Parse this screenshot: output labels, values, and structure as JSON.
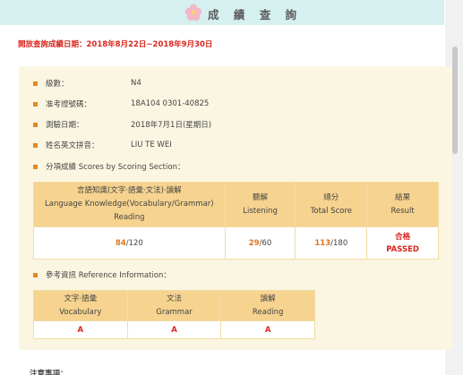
{
  "header": {
    "title": "成 績 查 詢",
    "icon": "flower-icon"
  },
  "notice": "開放查詢成績日期：2018年8月22日~2018年9月30日",
  "info": [
    {
      "label": "級數：",
      "value": "N4"
    },
    {
      "label": "准考證號碼：",
      "value": "18A104 0301-40825"
    },
    {
      "label": "測驗日期：",
      "value": "2018年7月1日(星期日)"
    },
    {
      "label": "姓名英文拼音：",
      "value": "LIU TE WEI"
    }
  ],
  "scoring_section_title": "分項成績 Scores by Scoring Section：",
  "score_table": {
    "headers": [
      {
        "line1": "言語知識(文字·語彙·文法)·讀解",
        "line2": "Language Knowledge(Vocabulary/Grammar)",
        "line3": "Reading"
      },
      {
        "line1": "聽解",
        "line2": "Listening"
      },
      {
        "line1": "總分",
        "line2": "Total Score"
      },
      {
        "line1": "結果",
        "line2": "Result"
      }
    ],
    "scores": [
      {
        "score": "84",
        "max": "/120"
      },
      {
        "score": "29",
        "max": "/60"
      },
      {
        "score": "113",
        "max": "/180"
      }
    ],
    "result": {
      "line1": "合格",
      "line2": "PASSED"
    }
  },
  "reference_title": "參考資訊 Reference Information：",
  "reference_table": {
    "headers": [
      {
        "line1": "文字·語彙",
        "line2": "Vocabulary"
      },
      {
        "line1": "文法",
        "line2": "Grammar"
      },
      {
        "line1": "讀解",
        "line2": "Reading"
      }
    ],
    "values": [
      "A",
      "A",
      "A"
    ]
  },
  "footer": "注意事項：",
  "colors": {
    "accent": "#e08a1e",
    "alert": "#d9251d",
    "header_bg": "#d6efef",
    "panel_bg": "#fbf6e1",
    "table_header": "#f6d38f"
  }
}
